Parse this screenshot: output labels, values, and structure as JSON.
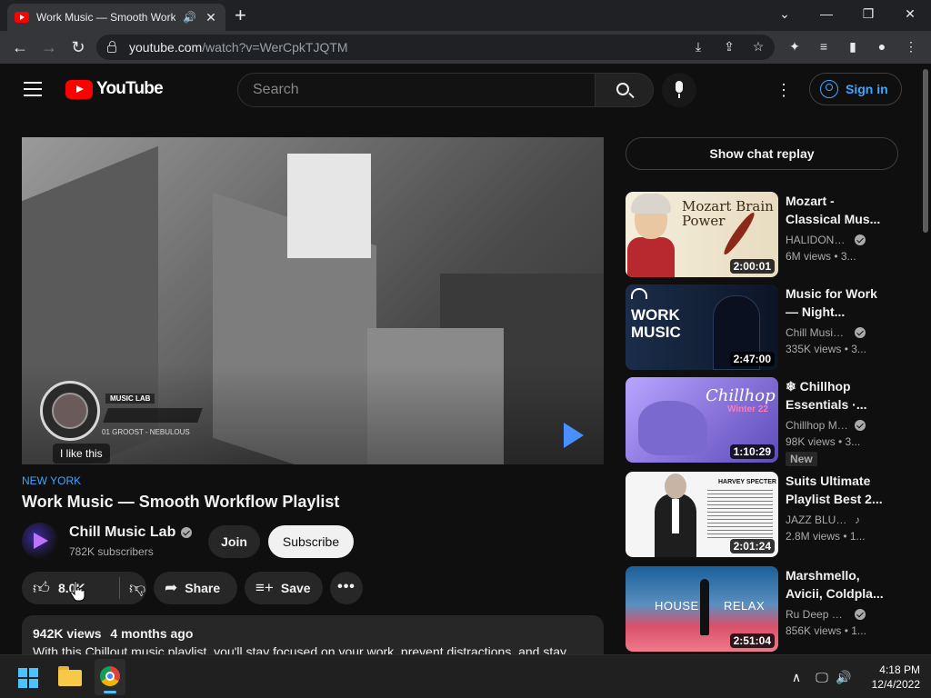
{
  "browser": {
    "tab_title": "Work Music — Smooth Workf",
    "new_tab": "+",
    "address_host": "youtube.com",
    "address_path": "/watch?v=WerCpkTJQTM",
    "window_controls": {
      "minimize": "—",
      "restore": "❐",
      "close": "✕",
      "tab_list": "⌄"
    }
  },
  "masthead": {
    "logo_text": "YouTube",
    "search_placeholder": "Search",
    "signin_label": "Sign in"
  },
  "player": {
    "overlay_brand": "MUSIC LAB",
    "overlay_track": "01 GROOST - NEBULOUS",
    "tooltip": "I like this"
  },
  "video": {
    "hashtag": "NEW YORK",
    "title": "Work Music — Smooth Workflow Playlist",
    "channel_name": "Chill Music Lab",
    "subscribers": "782K subscribers",
    "join_label": "Join",
    "subscribe_label": "Subscribe",
    "like_count": "8.0K",
    "share_label": "Share",
    "save_label": "Save",
    "more_label": "•••",
    "views": "942K views",
    "age": "4 months ago",
    "description": "With this Chillout music playlist, you'll stay focused on your work, prevent distractions, and stay"
  },
  "sidebar": {
    "chat_replay_label": "Show chat replay",
    "recommendations": [
      {
        "title_line1": "Mozart -",
        "title_line2": "Classical Mus...",
        "channel": "HALIDONM...",
        "verified": true,
        "meta": "6M views  • 3...",
        "duration": "2:00:01",
        "thumb_text": "Mozart Brain Power"
      },
      {
        "title_line1": "Music for Work",
        "title_line2": "— Night...",
        "channel": "Chill Music ...",
        "verified": true,
        "meta": "335K views  • 3...",
        "duration": "2:47:00",
        "thumb_text": "WORK MUSIC"
      },
      {
        "title_line1": "❄ Chillhop",
        "title_line2": "Essentials ·...",
        "channel": "Chillhop Mu...",
        "verified": true,
        "meta": "98K views  • 3...",
        "duration": "1:10:29",
        "badge": "New",
        "thumb_text": "Chillhop",
        "thumb_sub": "Winter 22"
      },
      {
        "title_line1": "Suits Ultimate",
        "title_line2": "Playlist Best 2...",
        "channel": "JAZZ BLUES",
        "music_note": "♪",
        "meta": "2.8M views  • 1...",
        "duration": "2:01:24",
        "thumb_text": "HARVEY SPECTER"
      },
      {
        "title_line1": "Marshmello,",
        "title_line2": "Avicii, Coldpla...",
        "channel": "Ru Deep Ra...",
        "verified": true,
        "meta": "856K views  • 1...",
        "duration": "2:51:04",
        "thumb_text_left": "HOUSE",
        "thumb_text_right": "RELAX"
      }
    ]
  },
  "taskbar": {
    "time": "4:18 PM",
    "date": "12/4/2022"
  },
  "colors": {
    "youtube_red": "#ff0000",
    "link_blue": "#3ea6ff",
    "background": "#0f0f0f"
  }
}
